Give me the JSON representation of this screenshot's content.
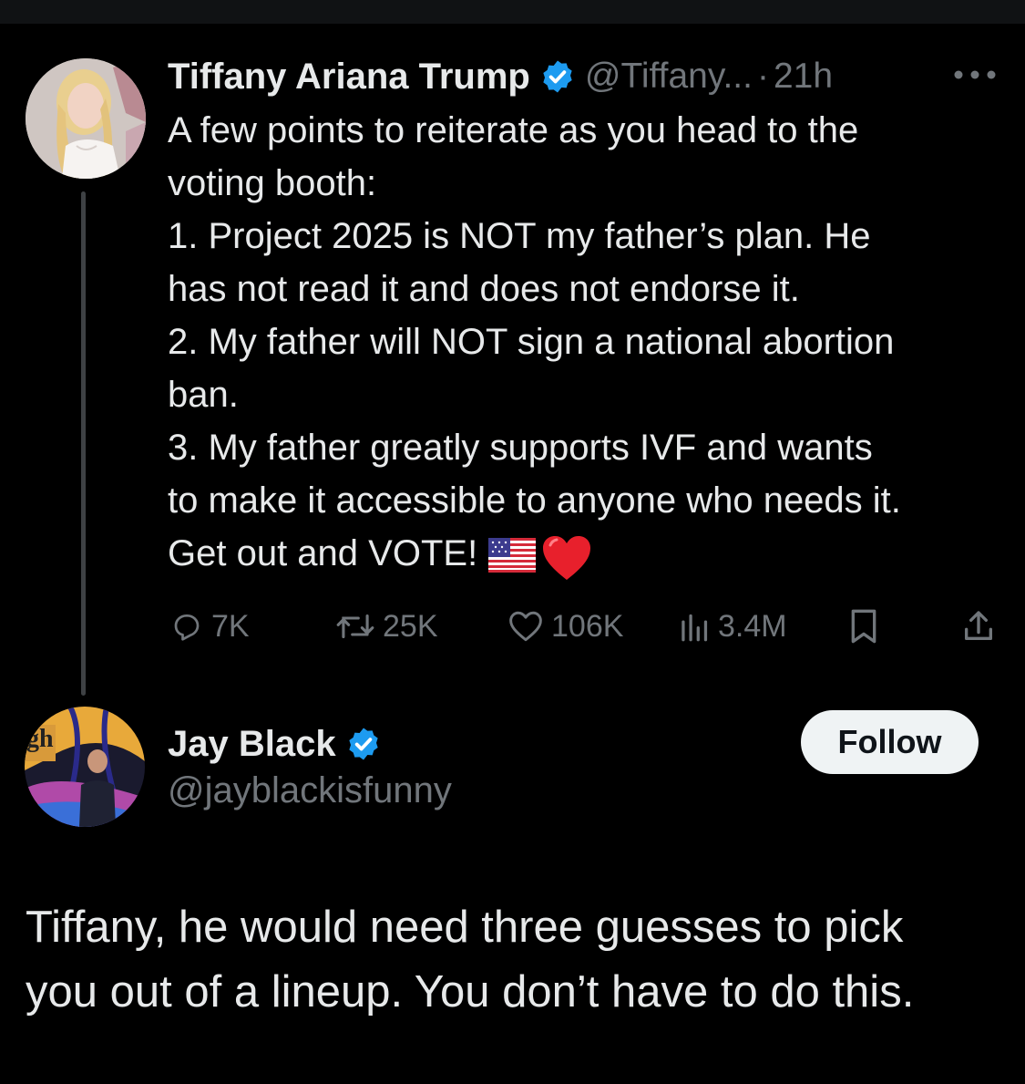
{
  "parent_tweet": {
    "author_name": "Tiffany Ariana Trump",
    "handle": "@Tiffany...",
    "separator": "·",
    "time": "21h",
    "body_lines": [
      "A few points to reiterate as you head to the",
      "voting booth:",
      "1. Project 2025 is NOT my father’s plan. He",
      "has not read it and does not endorse it.",
      "2. My father will NOT sign a national abortion",
      "ban.",
      "3. My father greatly supports IVF and wants",
      "to make it accessible to anyone who needs it.",
      "Get out and VOTE!"
    ],
    "emojis": [
      "us-flag-emoji",
      "red-heart-emoji"
    ],
    "stats": {
      "replies": "7K",
      "reposts": "25K",
      "likes": "106K",
      "views": "3.4M"
    }
  },
  "reply_tweet": {
    "author_name": "Jay Black",
    "handle": "@jayblackisfunny",
    "follow_label": "Follow",
    "body_lines": [
      "Tiffany, he would need three guesses to pick",
      "you out of a lineup. You don’t have to do this."
    ]
  },
  "colors": {
    "background": "#000000",
    "text_primary": "#e7e9ea",
    "text_secondary": "#71767b",
    "verified_blue": "#1d9bf0",
    "follow_button_bg": "#eff3f4"
  }
}
